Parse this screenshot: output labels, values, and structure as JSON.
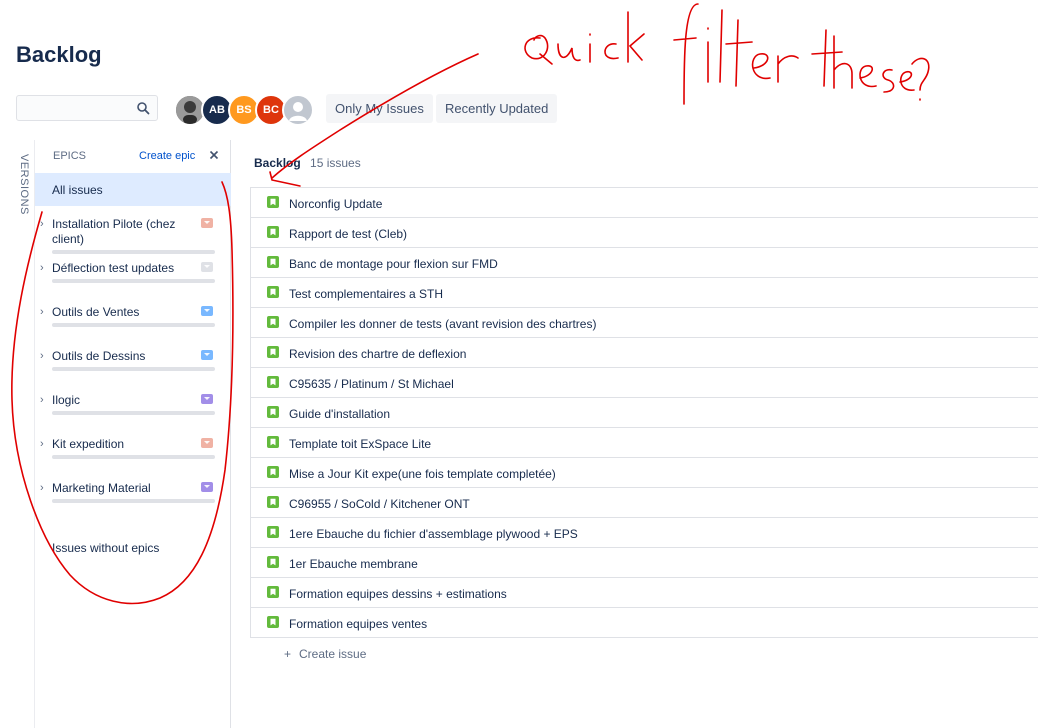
{
  "page": {
    "title": "Backlog"
  },
  "search": {
    "placeholder": ""
  },
  "avatars": [
    {
      "initials": "",
      "color": "#7a7a7a",
      "kind": "photo"
    },
    {
      "initials": "AB",
      "color": "#172b4d"
    },
    {
      "initials": "BS",
      "color": "#ff991f"
    },
    {
      "initials": "BC",
      "color": "#de350b"
    },
    {
      "initials": "",
      "color": "#c1c7d0",
      "kind": "placeholder"
    }
  ],
  "quick_filters": {
    "only_my_issues": "Only My Issues",
    "recently_updated": "Recently Updated"
  },
  "versions_tab": {
    "label": "VERSIONS"
  },
  "epics": {
    "title": "EPICS",
    "create_label": "Create epic",
    "all_issues_label": "All issues",
    "items": [
      {
        "name": "Installation Pilote (chez client)",
        "color": "#f0b2a4"
      },
      {
        "name": "Déflection test updates",
        "color": "#dfe1e6"
      },
      {
        "name": "Outils de Ventes",
        "color": "#79b8ff"
      },
      {
        "name": "Outils de Dessins",
        "color": "#79b8ff"
      },
      {
        "name": "Ilogic",
        "color": "#a28ee8"
      },
      {
        "name": "Kit expedition",
        "color": "#f0b2a4"
      },
      {
        "name": "Marketing Material",
        "color": "#a28ee8"
      }
    ],
    "no_epics_label": "Issues without epics"
  },
  "backlog": {
    "title": "Backlog",
    "count": "15 issues",
    "issues": [
      "Norconfig Update",
      "Rapport de test (Cleb)",
      "Banc de montage pour flexion sur FMD",
      "Test complementaires a STH",
      "Compiler les donner de tests (avant revision des chartres)",
      "Revision des chartre de deflexion",
      "C95635 / Platinum / St Michael",
      "Guide d'installation",
      "Template toit ExSpace Lite",
      "Mise a Jour Kit expe(une fois template completée)",
      "C96955 / SoCold / Kitchener ONT",
      "1ere Ebauche du fichier d'assemblage plywood + EPS",
      "1er Ebauche membrane",
      "Formation equipes dessins + estimations",
      "Formation equipes ventes"
    ],
    "create_issue_label": "Create issue"
  },
  "colors": {
    "story_icon": "#63ba3c",
    "selected": "#deebff",
    "link": "#0052cc",
    "annotation": "#e00000"
  },
  "annotation": {
    "text": "Quick filter these?"
  }
}
